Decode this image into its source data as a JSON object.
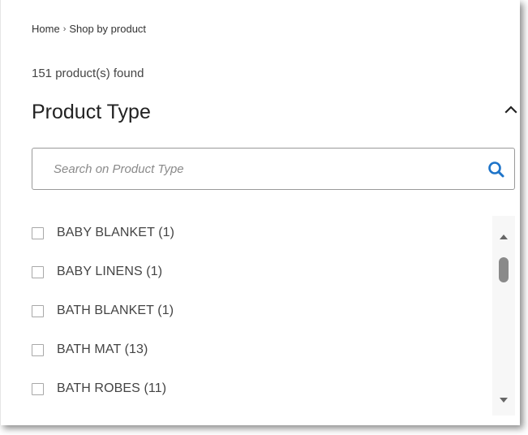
{
  "breadcrumb": {
    "items": [
      "Home",
      "Shop by product"
    ],
    "separator": "›"
  },
  "results": {
    "count_text": "151 product(s) found"
  },
  "filter": {
    "title": "Product Type",
    "collapse_icon": "chevron-up-icon",
    "search": {
      "placeholder": "Search on Product Type",
      "value": "",
      "icon": "search-icon",
      "icon_color": "#1e74c9"
    },
    "options": [
      {
        "label": "BABY BLANKET (1)",
        "checked": false
      },
      {
        "label": "BABY LINENS (1)",
        "checked": false
      },
      {
        "label": "BATH BLANKET (1)",
        "checked": false
      },
      {
        "label": "BATH MAT (13)",
        "checked": false
      },
      {
        "label": "BATH ROBES (11)",
        "checked": false
      }
    ]
  },
  "colors": {
    "text": "#333333",
    "accent": "#1e74c9",
    "border": "#9a9a9a",
    "scroll_thumb": "#8a8a8a"
  }
}
